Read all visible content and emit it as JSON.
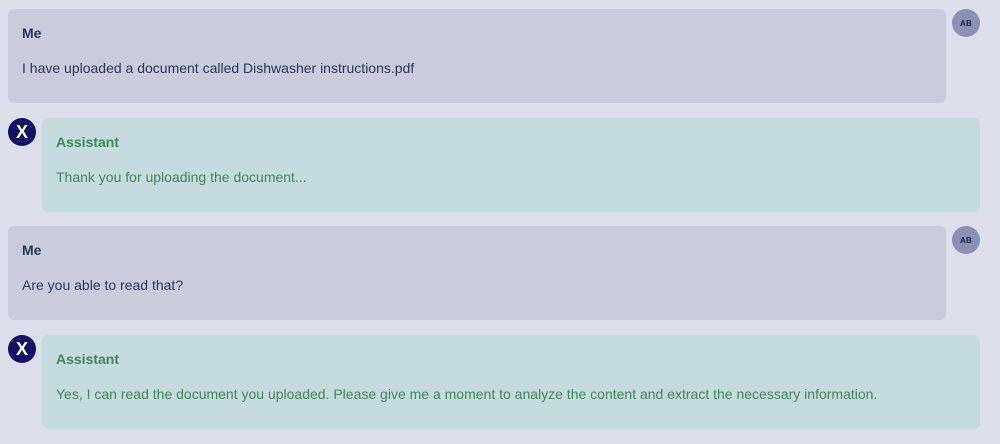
{
  "messages": [
    {
      "role": "me",
      "sender": "Me",
      "text": "I have uploaded a document called Dishwasher instructions.pdf",
      "avatar": "AB"
    },
    {
      "role": "assistant",
      "sender": "Assistant",
      "text": "Thank you for uploading the document...",
      "avatar": "X"
    },
    {
      "role": "me",
      "sender": "Me",
      "text": "Are you able to read that?",
      "avatar": "AB"
    },
    {
      "role": "assistant",
      "sender": "Assistant",
      "text": "Yes, I can read the document you uploaded. Please give me a moment to analyze the content and extract the necessary information.",
      "avatar": "X"
    }
  ],
  "colors": {
    "page_background": "#dcdfe9",
    "user_bubble": "#caccdc",
    "user_text": "#2f3557",
    "assistant_bubble": "#c6dbdd",
    "assistant_text": "#3e8a58",
    "user_avatar": "#8a91b2",
    "assistant_avatar": "#121064"
  }
}
